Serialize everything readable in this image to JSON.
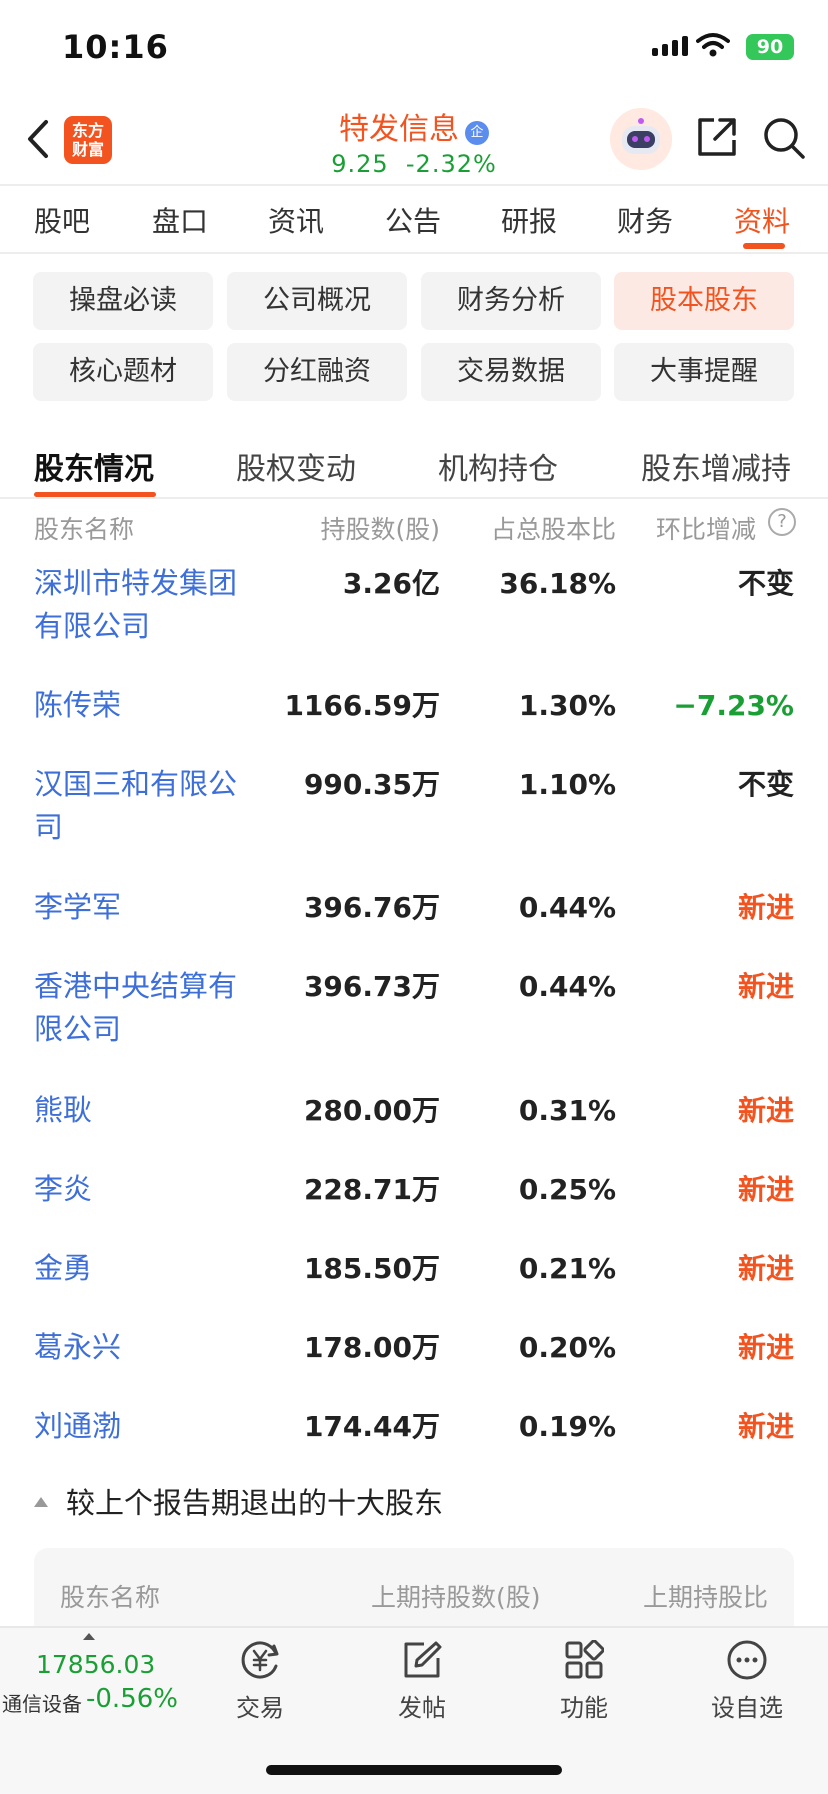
{
  "status_bar": {
    "time": "10:16",
    "battery": "90"
  },
  "header": {
    "logo_line1": "东方",
    "logo_line2": "财富",
    "stock_name": "特发信息",
    "badge": "企",
    "price": "9.25",
    "change_pct": "-2.32%"
  },
  "tabs": [
    {
      "label": "股吧"
    },
    {
      "label": "盘口"
    },
    {
      "label": "资讯"
    },
    {
      "label": "公告"
    },
    {
      "label": "研报"
    },
    {
      "label": "财务"
    },
    {
      "label": "资料"
    }
  ],
  "grid_buttons": [
    {
      "label": "操盘必读"
    },
    {
      "label": "公司概况"
    },
    {
      "label": "财务分析"
    },
    {
      "label": "股本股东"
    },
    {
      "label": "核心题材"
    },
    {
      "label": "分红融资"
    },
    {
      "label": "交易数据"
    },
    {
      "label": "大事提醒"
    }
  ],
  "sub_tabs": [
    {
      "label": "股东情况"
    },
    {
      "label": "股权变动"
    },
    {
      "label": "机构持仓"
    },
    {
      "label": "股东增减持"
    }
  ],
  "table": {
    "headers": {
      "name": "股东名称",
      "shares": "持股数(股)",
      "ratio": "占总股本比",
      "change": "环比增减",
      "help": "?"
    },
    "rows": [
      {
        "name": "深圳市特发集团有限公司",
        "shares": "3.26亿",
        "ratio": "36.18%",
        "change": "不变"
      },
      {
        "name": "陈传荣",
        "shares": "1166.59万",
        "ratio": "1.30%",
        "change": "−7.23%"
      },
      {
        "name": "汉国三和有限公司",
        "shares": "990.35万",
        "ratio": "1.10%",
        "change": "不变"
      },
      {
        "name": "李学军",
        "shares": "396.76万",
        "ratio": "0.44%",
        "change": "新进"
      },
      {
        "name": "香港中央结算有限公司",
        "shares": "396.73万",
        "ratio": "0.44%",
        "change": "新进"
      },
      {
        "name": "熊耿",
        "shares": "280.00万",
        "ratio": "0.31%",
        "change": "新进"
      },
      {
        "name": "李炎",
        "shares": "228.71万",
        "ratio": "0.25%",
        "change": "新进"
      },
      {
        "name": "金勇",
        "shares": "185.50万",
        "ratio": "0.21%",
        "change": "新进"
      },
      {
        "name": "葛永兴",
        "shares": "178.00万",
        "ratio": "0.20%",
        "change": "新进"
      },
      {
        "name": "刘通渤",
        "shares": "174.44万",
        "ratio": "0.19%",
        "change": "新进"
      }
    ]
  },
  "exited": {
    "title": "较上个报告期退出的十大股东",
    "headers": {
      "name": "股东名称",
      "prev_shares": "上期持股数(股)",
      "prev_ratio": "上期持股比"
    }
  },
  "bottom_bar": {
    "index_value": "17856.03",
    "index_name": "通信设备",
    "index_change": "-0.56%",
    "items": [
      {
        "label": "交易",
        "icon": "yen-circle-icon"
      },
      {
        "label": "发帖",
        "icon": "edit-icon"
      },
      {
        "label": "功能",
        "icon": "grid-icon"
      },
      {
        "label": "设自选",
        "icon": "more-icon"
      }
    ]
  },
  "colors": {
    "accent": "#f2531f",
    "down": "#1a9f35",
    "link": "#3e6fd8"
  }
}
